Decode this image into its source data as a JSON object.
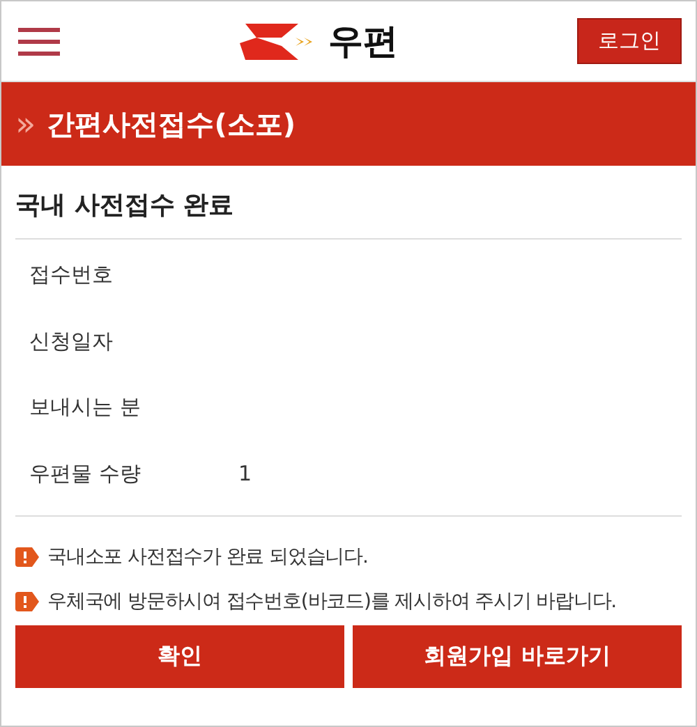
{
  "header": {
    "brand": "우편",
    "login_button": "로그인"
  },
  "banner": {
    "arrow": "»",
    "title": "간편사전접수(소포)"
  },
  "section": {
    "title": "국내 사전접수 완료",
    "rows": [
      {
        "label": "접수번호"
      },
      {
        "label": "신청일자"
      },
      {
        "label": "보내시는 분"
      },
      {
        "label": "우편물 수량",
        "value": "1"
      }
    ]
  },
  "notices": [
    "국내소포 사전접수가 완료 되었습니다.",
    "우체국에 방문하시여 접수번호(바코드)를 제시하여 주시기 바랍니다."
  ],
  "buttons": [
    "확인",
    "회원가입 바로가기"
  ]
}
